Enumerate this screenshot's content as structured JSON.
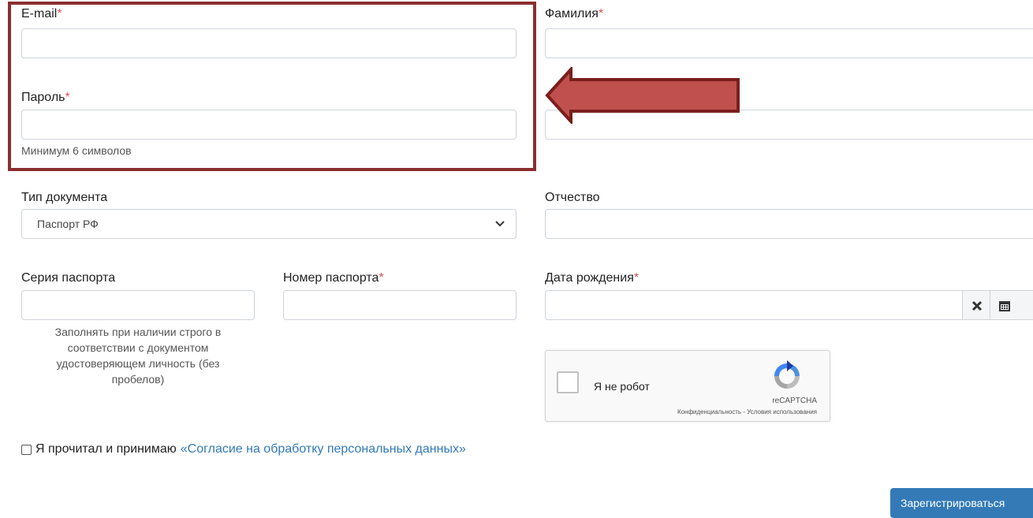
{
  "form": {
    "email": {
      "label": "E-mail",
      "required_mark": "*",
      "value": "",
      "placeholder": ""
    },
    "password": {
      "label": "Пароль",
      "required_mark": "*",
      "value": "",
      "placeholder": "",
      "hint": "Минимум 6 символов"
    },
    "last_name": {
      "label": "Фамилия",
      "required_mark": "*",
      "value": "",
      "placeholder": ""
    },
    "first_name": {
      "value": "",
      "placeholder": ""
    },
    "doc_type": {
      "label": "Тип документа",
      "selected": "Паспорт РФ",
      "icon": "chevron-down-icon"
    },
    "patronymic": {
      "label": "Отчество",
      "value": "",
      "placeholder": ""
    },
    "passport_series": {
      "label": "Серия паспорта",
      "value": "",
      "placeholder": "",
      "hint": "Заполнять при наличии строго в соответствии с документом удостоверяющем личность (без пробелов)"
    },
    "passport_number": {
      "label": "Номер паспорта",
      "required_mark": "*",
      "value": "",
      "placeholder": ""
    },
    "birth_date": {
      "label": "Дата рождения",
      "required_mark": "*",
      "value": "",
      "placeholder": "",
      "clear_icon": "close-icon",
      "calendar_icon": "calendar-icon"
    }
  },
  "recaptcha": {
    "label": "Я не робот",
    "brand": "reCAPTCHA",
    "links": "Конфиденциальность - Условия использования",
    "icon": "recaptcha-icon"
  },
  "consent": {
    "text": "Я прочитал и принимаю",
    "link": "«Согласие на обработку персональных данных»",
    "checked": false
  },
  "submit": {
    "label": "Зарегистрироваться"
  },
  "annotation": {
    "box_color": "#8b2e2e",
    "arrow_color": "#c0504d"
  },
  "colors": {
    "primary": "#337ab7",
    "required": "#d9534f",
    "link": "#337ab7"
  }
}
